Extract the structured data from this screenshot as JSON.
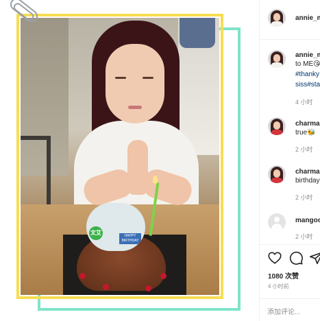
{
  "post": {
    "username": "annie_m"
  },
  "caption": {
    "username": "annie_m",
    "lines": [
      "to ME😘",
      "#thanky",
      "siss#sta"
    ],
    "time": "4 小时"
  },
  "comments": [
    {
      "username": "charma",
      "text": "true🐝",
      "time": "2 小时"
    },
    {
      "username": "charma",
      "text": "birthday",
      "time": "2 小时"
    },
    {
      "username": "mangoo",
      "text": "",
      "time": "2 小时"
    }
  ],
  "cake_topper": {
    "badge": "文艾",
    "text": "HAPPY BIRTHDAY"
  },
  "actions": {
    "likes": "1080 次赞",
    "time": "4 小时前",
    "comment_placeholder": "添加评论..."
  },
  "colors": {
    "frame_yellow": "#f6dd53",
    "frame_green": "#7fe3c8",
    "link": "#00376b",
    "muted": "#8e8e8e"
  },
  "icons": [
    "heart-icon",
    "comment-icon",
    "share-icon",
    "paperclip-icon"
  ]
}
